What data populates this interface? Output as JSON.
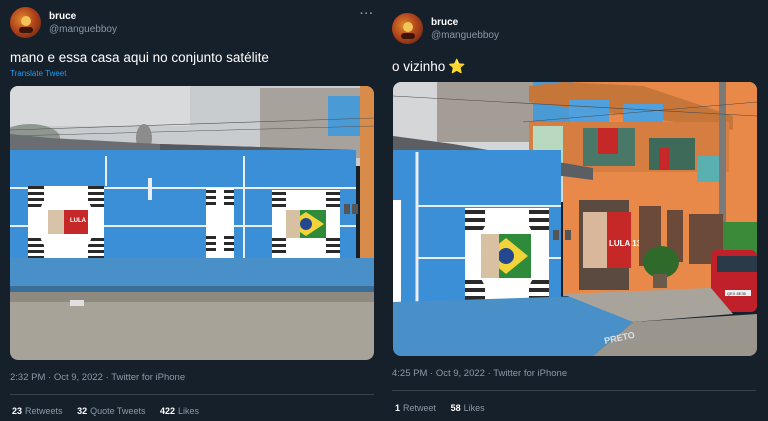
{
  "tweets": [
    {
      "display_name": "bruce",
      "handle": "@manguebboy",
      "more_label": "···",
      "text": "mano e essa casa aqui no conjunto satélite",
      "translate_label": "Translate Tweet",
      "poster_text": "LULA 13",
      "timestamp": "2:32 PM · Oct 9, 2022 · Twitter for iPhone",
      "stats": [
        {
          "count": "23",
          "label": "Retweets"
        },
        {
          "count": "32",
          "label": "Quote Tweets"
        },
        {
          "count": "422",
          "label": "Likes"
        }
      ]
    },
    {
      "display_name": "bruce",
      "handle": "@manguebboy",
      "more_label": "···",
      "text": "o vizinho",
      "emoji": "⭐",
      "poster_text": "LULA 13",
      "graffiti": "PRETO",
      "plate": "QEX 8E35",
      "timestamp": "4:25 PM · Oct 9, 2022 · Twitter for iPhone",
      "stats": [
        {
          "count": "1",
          "label": "Retweet"
        },
        {
          "count": "58",
          "label": "Likes"
        }
      ]
    }
  ],
  "colors": {
    "background": "#15202b",
    "secondary_text": "#8b98a5",
    "link": "#1d9bf0",
    "divider": "#38444d",
    "house_blue": "#3a8fd6",
    "house_orange": "#e8894a"
  },
  "icons": [
    "avatar",
    "more-icon",
    "star-emoji"
  ]
}
